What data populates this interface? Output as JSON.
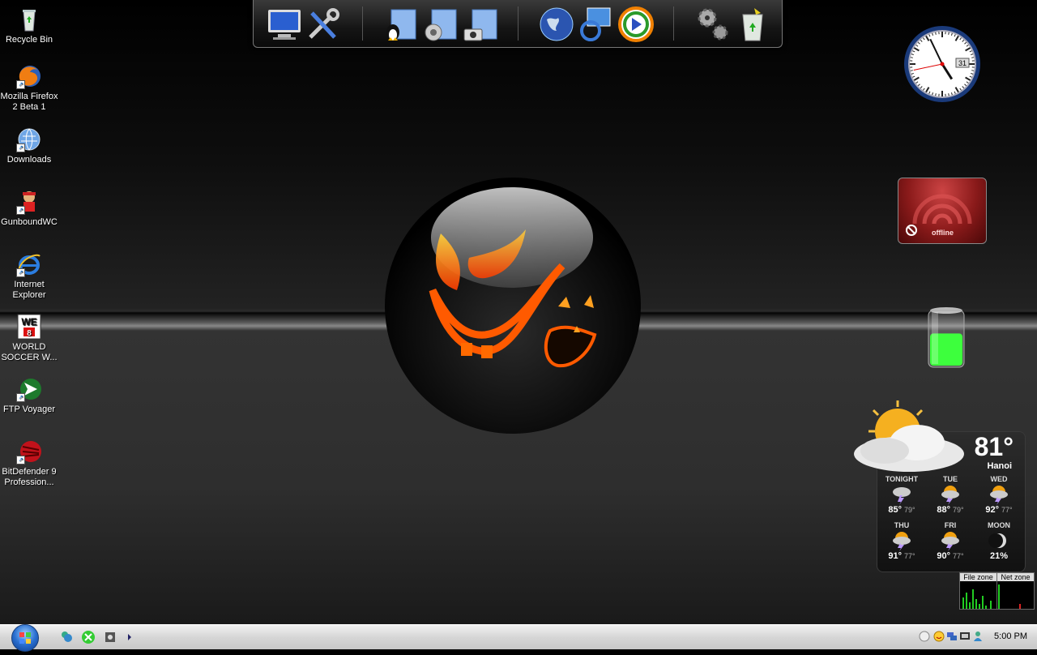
{
  "desktop": {
    "icons": [
      {
        "label": "Recycle Bin",
        "icon": "recycle-bin-icon"
      },
      {
        "label": "Mozilla Firefox 2 Beta 1",
        "icon": "firefox-icon"
      },
      {
        "label": "Downloads",
        "icon": "downloads-icon"
      },
      {
        "label": "GunboundWC",
        "icon": "gunbound-icon"
      },
      {
        "label": "Internet Explorer",
        "icon": "internet-explorer-icon"
      },
      {
        "label": "WORLD SOCCER W...",
        "icon": "world-soccer-icon",
        "badge": "WE"
      },
      {
        "label": "FTP Voyager",
        "icon": "ftp-voyager-icon"
      },
      {
        "label": "BitDefender 9 Profession...",
        "icon": "bitdefender-icon"
      }
    ]
  },
  "dock": {
    "items": [
      "my-computer-icon",
      "tools-icon",
      "linux-folder-icon",
      "music-folder-icon",
      "pictures-folder-icon",
      "globe-icon",
      "mail-icon",
      "media-player-icon",
      "settings-gears-icon",
      "recycle-bin-icon"
    ]
  },
  "clock": {
    "date": "31",
    "hour": 4,
    "minute": 55,
    "second": 43
  },
  "network": {
    "status": "offline"
  },
  "battery": {
    "level_percent": 60,
    "color": "#3dff3d"
  },
  "weather": {
    "current_temp": "81°",
    "city": "Hanoi",
    "forecast": [
      {
        "day": "TONIGHT",
        "hi": "85°",
        "lo": "79°",
        "icon": "thunderstorm-icon"
      },
      {
        "day": "TUE",
        "hi": "88°",
        "lo": "79°",
        "icon": "sun-thunderstorm-icon"
      },
      {
        "day": "WED",
        "hi": "92°",
        "lo": "77°",
        "icon": "sun-thunderstorm-icon"
      },
      {
        "day": "THU",
        "hi": "91°",
        "lo": "77°",
        "icon": "sun-thunderstorm-icon"
      },
      {
        "day": "FRI",
        "hi": "90°",
        "lo": "77°",
        "icon": "sun-thunderstorm-icon"
      },
      {
        "day": "MOON",
        "hi": "21%",
        "lo": "",
        "icon": "moon-phase-icon"
      }
    ]
  },
  "meters": {
    "file_zone": "File zone",
    "net_zone": "Net zone"
  },
  "taskbar": {
    "time": "5:00 PM",
    "quick_launch": [
      "messenger-icon",
      "xbox-icon",
      "media-icon",
      "more-arrow-icon"
    ],
    "tray": [
      "tray-circle-icon",
      "tray-smiley-icon",
      "tray-network-icon",
      "tray-monitor-icon",
      "tray-user-icon"
    ]
  },
  "colors": {
    "accent_orange": "#ff6a00",
    "wallpaper_dark": "#000000"
  }
}
